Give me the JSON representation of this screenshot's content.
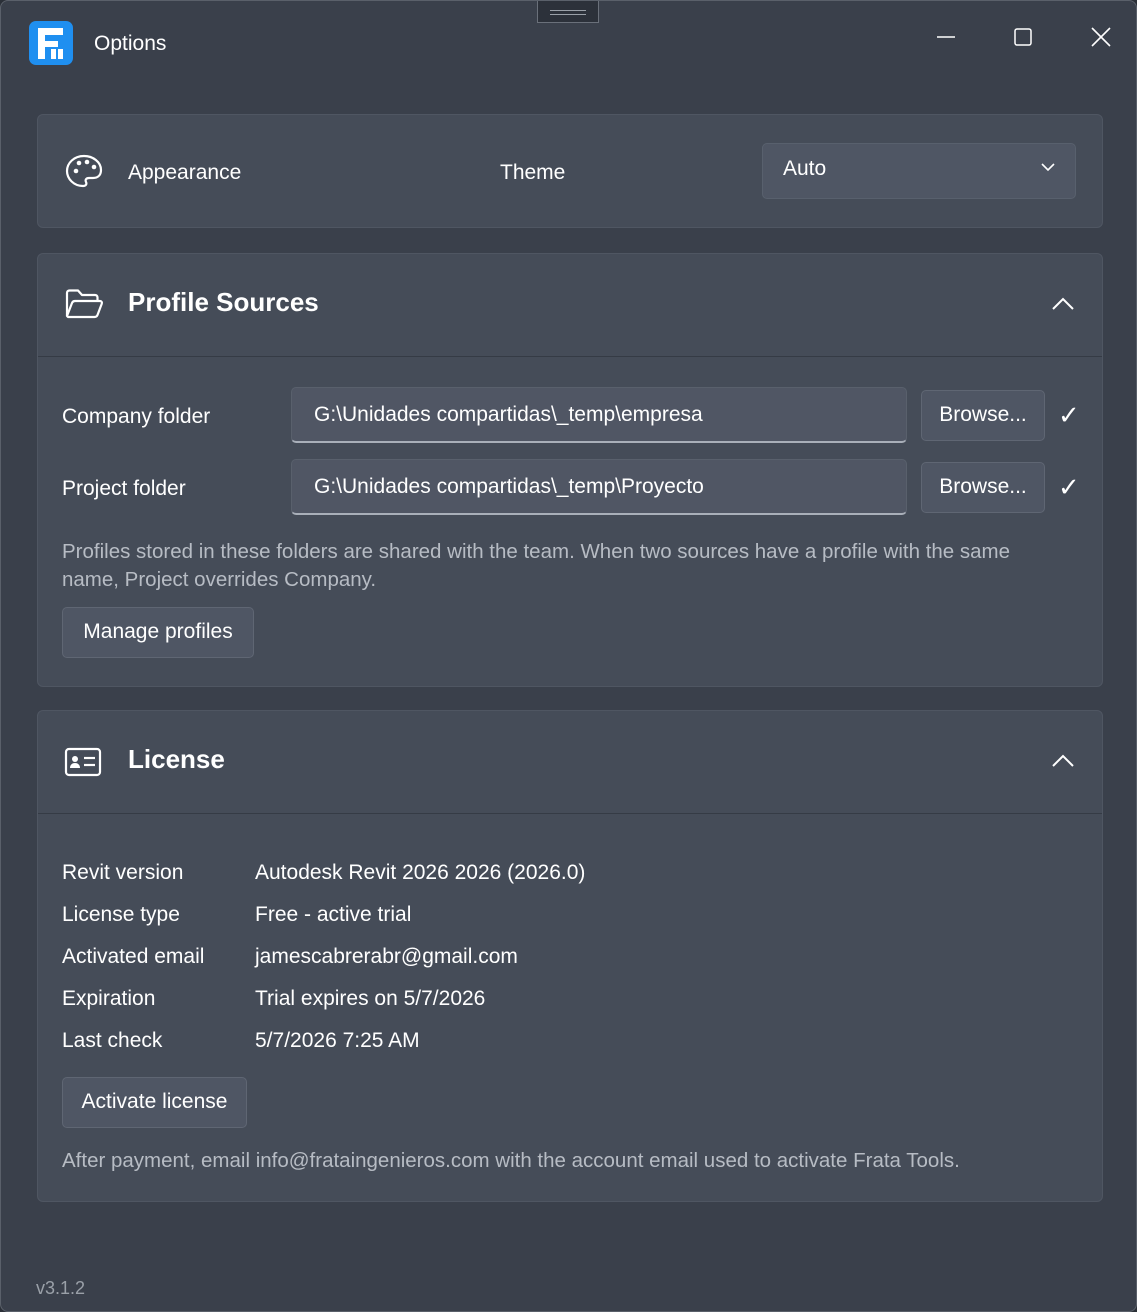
{
  "window": {
    "title": "Options",
    "icon": "frata-logo-icon",
    "accent_color": "#1f8ff0"
  },
  "appearance": {
    "label": "Appearance",
    "icon": "palette-icon",
    "theme_label": "Theme",
    "theme_value": "Auto"
  },
  "profile_sources": {
    "title": "Profile Sources",
    "icon": "folder-open-icon",
    "company_label": "Company folder",
    "company_value": "G:\\Unidades compartidas\\_temp\\empresa",
    "project_label": "Project folder",
    "project_value": "G:\\Unidades compartidas\\_temp\\Proyecto",
    "browse_label": "Browse...",
    "check_mark": "✓",
    "help_text": "Profiles stored in these folders are shared with the team. When two sources have a profile with the same name, Project overrides Company.",
    "manage_label": "Manage profiles"
  },
  "license": {
    "title": "License",
    "icon": "id-card-icon",
    "rows": [
      {
        "label": "Revit version",
        "value": "Autodesk Revit 2026 2026 (2026.0)"
      },
      {
        "label": "License type",
        "value": "Free - active trial"
      },
      {
        "label": "Activated email",
        "value": "jamescabrerabr@gmail.com"
      },
      {
        "label": "Expiration",
        "value": "Trial expires on 5/7/2026"
      },
      {
        "label": "Last check",
        "value": "5/7/2026 7:25 AM"
      }
    ],
    "activate_label": "Activate license",
    "note": "After payment, email info@frataingenieros.com with the account email used to activate Frata Tools."
  },
  "footer": {
    "version": "v3.1.2"
  }
}
